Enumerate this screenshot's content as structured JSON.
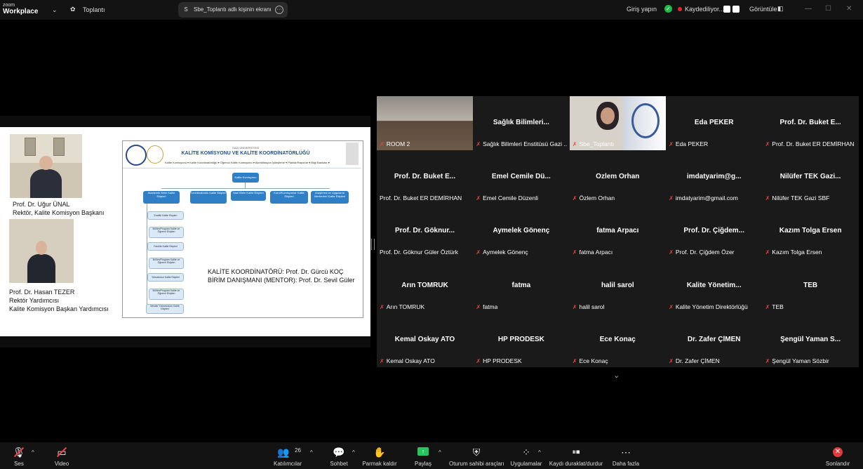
{
  "topbar": {
    "logo_line1": "zoom",
    "logo_line2": "Workplace",
    "meeting_label": "Toplantı",
    "share_avatar": "S",
    "share_label": "Sbe_Toplantı adlı kişinin ekranı",
    "login": "Giriş yapın",
    "recording": "Kaydediliyor...",
    "view": "Görüntüle"
  },
  "slide": {
    "rector_name": "Prof. Dr. Uğur ÜNAL",
    "rector_title": "Rektör, Kalite Komisyon Başkanı",
    "vice_name": "Prof. Dr. Hasan TEZER",
    "vice_title1": "Rektör Yardımcısı",
    "vice_title2": "Kalite Komisyon Başkan Yardımcısı",
    "org_university": "GAZİ ÜNİVERSİTESİ",
    "org_title": "KALİTE KOMİSYONU VE KALİTE KOORDİNATÖRLÜĞÜ",
    "org_menu": "Kalite Komisyonu ▾   Kalite Koordinatörlüğü ▾   Öğrenci Kalite Komisyonu ▾   Akreditasyon   İyileştirme ▾   Planlar/Raporlar ▾   Bilgi Bankası ▾",
    "org_root": "Kalite Komisyonu",
    "org_nodes": [
      "Akademik Birim Kalite Ekipleri",
      "Koordinatörlük Kalite Ekipleri",
      "İdari Birim Kalite Ekipleri",
      "Kurul/Komisyonlar Kalite Ekipleri",
      "Araştırma ve Uygulama Merkezleri Kalite Ekipleri"
    ],
    "org_subnodes": [
      "Enstitü Kalite Ekipleri",
      "Bölüm/Program Kalite ve Öğrenci Ekipleri",
      "Fakülte Kalite Ekipleri",
      "Bölüm/Program Kalite ve Öğrenci Ekipleri",
      "Yüksekokul Kalite Ekipleri",
      "Bölüm/Program Kalite ve Öğrenci Ekipleri",
      "Meslek Yüksekokulu Kalite Ekipleri"
    ],
    "coord_line1": "KALİTE KOORDİNATÖRÜ: Prof. Dr. Gürcü KOÇ",
    "coord_line2": "BİRİM DANIŞMANI (MENTOR): Prof. Dr. Sevil Güler"
  },
  "participants": [
    {
      "display": "",
      "label": "ROOM 2",
      "video": true,
      "active": true
    },
    {
      "display": "Sağlık  Bilimleri...",
      "label": "Sağlık Bilimleri Enstitüsü Gazi ...",
      "video": false
    },
    {
      "display": "",
      "label": "Sbe_Toplantı",
      "video": true
    },
    {
      "display": "Eda PEKER",
      "label": "Eda PEKER",
      "video": false
    },
    {
      "display": "Prof. Dr. Buket E...",
      "label": "Prof. Dr. Buket ER DEMİRHAN",
      "video": false
    },
    {
      "display": "Prof. Dr. Buket E...",
      "label": "Prof. Dr. Buket ER DEMİRHAN",
      "video": false,
      "nomic": true
    },
    {
      "display": "Emel  Cemile  Dü...",
      "label": "Emel Cemile Düzenli",
      "video": false
    },
    {
      "display": "Özlem Orhan",
      "label": "Özlem Orhan",
      "video": false
    },
    {
      "display": "imdatyarim@g...",
      "label": "imdatyarim@gmail.com",
      "video": false
    },
    {
      "display": "Nilüfer TEK Gazi...",
      "label": "Nilüfer TEK Gazi SBF",
      "video": false
    },
    {
      "display": "Prof. Dr. Göknur...",
      "label": "Prof. Dr. Göknur Güler Öztürk",
      "video": false,
      "nomic": true
    },
    {
      "display": "Aymelek Gönenç",
      "label": "Aymelek Gönenç",
      "video": false
    },
    {
      "display": "fatma Arpacı",
      "label": "fatma Arpacı",
      "video": false
    },
    {
      "display": "Prof. Dr. Çiğdem...",
      "label": "Prof. Dr. Çiğdem Özer",
      "video": false
    },
    {
      "display": "Kazım Tolga Ersen",
      "label": "Kazım Tolga Ersen",
      "video": false
    },
    {
      "display": "Arın TOMRUK",
      "label": "Arın TOMRUK",
      "video": false
    },
    {
      "display": "fatma",
      "label": "fatma",
      "video": false
    },
    {
      "display": "halil sarol",
      "label": "halil sarol",
      "video": false
    },
    {
      "display": "Kalite  Yönetim...",
      "label": "Kalite Yönetim Direktörlüğü",
      "video": false
    },
    {
      "display": "TEB",
      "label": "TEB",
      "video": false
    },
    {
      "display": "Kemal  Oskay ATO",
      "label": "Kemal  Oskay ATO",
      "video": false
    },
    {
      "display": "HP PRODESK",
      "label": "HP PRODESK",
      "video": false
    },
    {
      "display": "Ece Konaç",
      "label": "Ece Konaç",
      "video": false
    },
    {
      "display": "Dr. Zafer ÇİMEN",
      "label": "Dr. Zafer ÇİMEN",
      "video": false
    },
    {
      "display": "Şengül Yaman S...",
      "label": "Şengül Yaman Sözbir",
      "video": false
    }
  ],
  "toolbar": {
    "audio": "Ses",
    "video": "Video",
    "participants": "Katılımcılar",
    "participants_count": "26",
    "chat": "Sohbet",
    "raise_hand": "Parmak kaldır",
    "share": "Paylaş",
    "host_tools": "Oturum sahibi araçları",
    "apps": "Uygulamalar",
    "record": "Kaydı duraklat/durdur",
    "more": "Daha fazla",
    "end": "Sonlandır"
  },
  "colors": {
    "active_border": "#22c55e",
    "mic_muted": "#e44444",
    "share": "#22c55e",
    "end": "#e03a3a"
  }
}
